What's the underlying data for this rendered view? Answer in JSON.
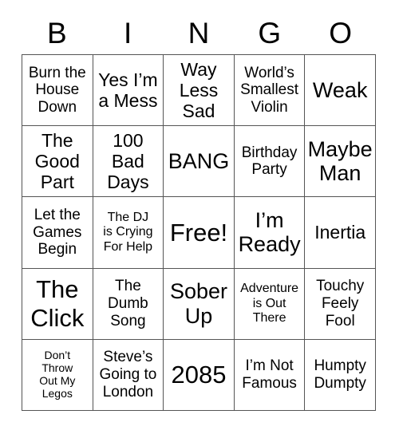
{
  "card": {
    "header": {
      "letters": [
        "B",
        "I",
        "N",
        "G",
        "O"
      ]
    },
    "rows": [
      [
        {
          "text": "Burn the\nHouse\nDown",
          "size": "fs-md"
        },
        {
          "text": "Yes I’m\na Mess",
          "size": "fs-lg"
        },
        {
          "text": "Way\nLess\nSad",
          "size": "fs-lg"
        },
        {
          "text": "World’s\nSmallest\nViolin",
          "size": "fs-md"
        },
        {
          "text": "Weak",
          "size": "fs-xl"
        }
      ],
      [
        {
          "text": "The\nGood\nPart",
          "size": "fs-lg"
        },
        {
          "text": "100\nBad\nDays",
          "size": "fs-lg"
        },
        {
          "text": "BANG",
          "size": "fs-xl"
        },
        {
          "text": "Birthday\nParty",
          "size": "fs-md"
        },
        {
          "text": "Maybe\nMan",
          "size": "fs-xl"
        }
      ],
      [
        {
          "text": "Let the\nGames\nBegin",
          "size": "fs-md"
        },
        {
          "text": "The DJ\nis Crying\nFor Help",
          "size": "fs-sm"
        },
        {
          "text": "Free!",
          "size": "fs-xxl"
        },
        {
          "text": "I’m\nReady",
          "size": "fs-xl"
        },
        {
          "text": "Inertia",
          "size": "fs-lg"
        }
      ],
      [
        {
          "text": "The\nClick",
          "size": "fs-xxl"
        },
        {
          "text": "The\nDumb\nSong",
          "size": "fs-md"
        },
        {
          "text": "Sober\nUp",
          "size": "fs-xl"
        },
        {
          "text": "Adventure\nis Out\nThere",
          "size": "fs-sm"
        },
        {
          "text": "Touchy\nFeely\nFool",
          "size": "fs-md"
        }
      ],
      [
        {
          "text": "Don’t\nThrow\nOut My\nLegos",
          "size": "fs-xs"
        },
        {
          "text": "Steve’s\nGoing to\nLondon",
          "size": "fs-md"
        },
        {
          "text": "2085",
          "size": "fs-xxl"
        },
        {
          "text": "I’m Not\nFamous",
          "size": "fs-md"
        },
        {
          "text": "Humpty\nDumpty",
          "size": "fs-md"
        }
      ]
    ],
    "colors": {
      "background": "#ffffff",
      "text": "#000000",
      "grid_line": "#555555"
    }
  }
}
